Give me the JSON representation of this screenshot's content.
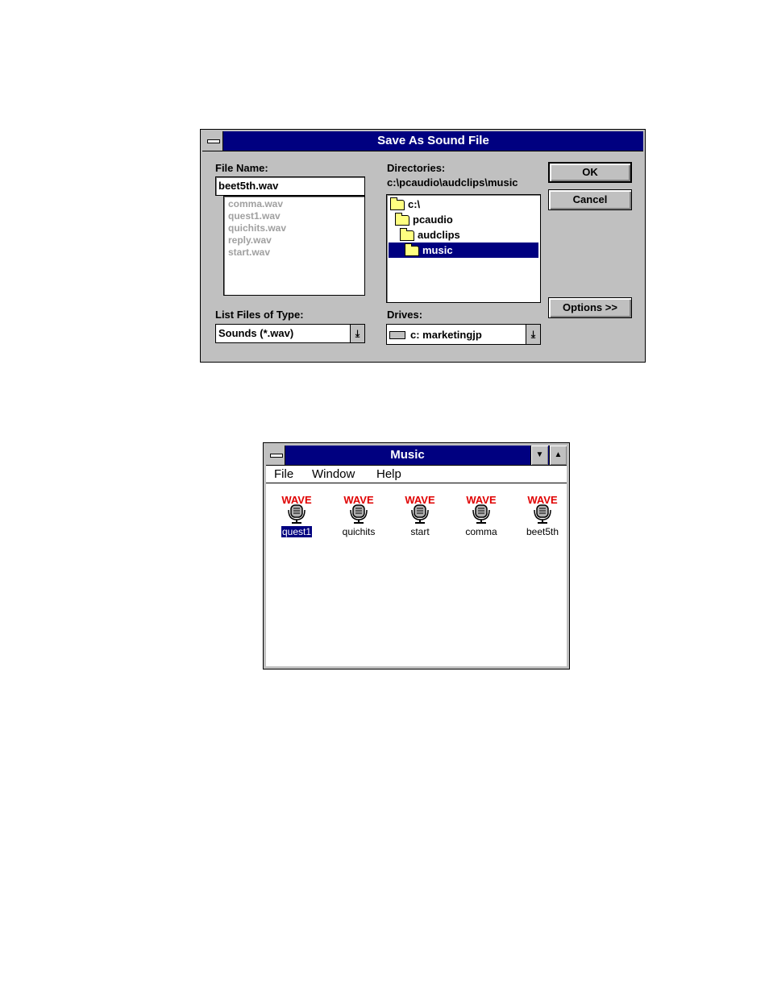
{
  "save_dialog": {
    "title": "Save As Sound File",
    "file_name_label": "File Name:",
    "file_name_value": "beet5th.wav",
    "files": [
      "comma.wav",
      "quest1.wav",
      "quichits.wav",
      "reply.wav",
      "start.wav"
    ],
    "directories_label": "Directories:",
    "current_path": "c:\\pcaudio\\audclips\\music",
    "directory_tree": [
      {
        "name": "c:\\",
        "selected": false
      },
      {
        "name": "pcaudio",
        "selected": false
      },
      {
        "name": "audclips",
        "selected": false
      },
      {
        "name": "music",
        "selected": true
      }
    ],
    "list_type_label": "List Files of Type:",
    "list_type_value": "Sounds (*.wav)",
    "drives_label": "Drives:",
    "drives_value": "c: marketingjp",
    "ok_label": "OK",
    "cancel_label": "Cancel",
    "options_label": "Options >>"
  },
  "music_window": {
    "title": "Music",
    "menu": [
      "File",
      "Window",
      "Help"
    ],
    "icon_caption": "WAVE",
    "icons": [
      {
        "label": "quest1",
        "selected": true
      },
      {
        "label": "quichits",
        "selected": false
      },
      {
        "label": "start",
        "selected": false
      },
      {
        "label": "comma",
        "selected": false
      },
      {
        "label": "beet5th",
        "selected": false
      }
    ]
  },
  "colors": {
    "titlebar": "#000080",
    "dialog_face": "#c0c0c0",
    "wave_text": "#e00000"
  }
}
